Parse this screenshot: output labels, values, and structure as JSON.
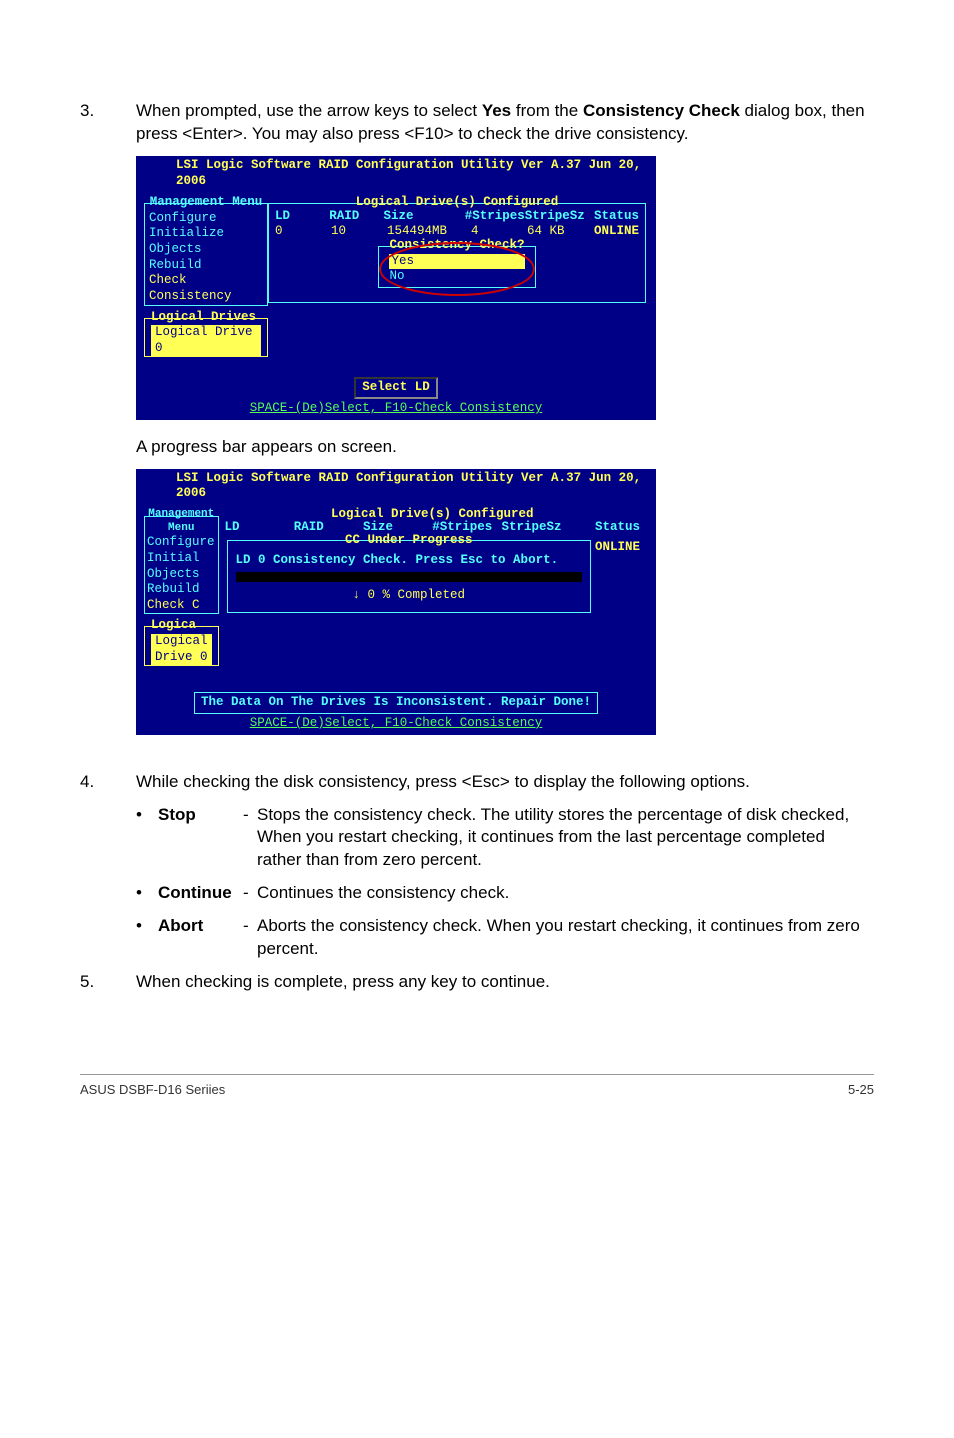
{
  "step3": {
    "num": "3.",
    "text_pre": "When prompted, use the arrow keys to select ",
    "bold1": "Yes",
    "text_mid": " from the ",
    "bold2": "Consistency Check",
    "text_post": " dialog box, then press <Enter>. You may also press <F10> to check the drive consistency."
  },
  "console1": {
    "title": "LSI Logic Software RAID Configuration Utility Ver A.37 Jun 20, 2006",
    "menu_title": "Management Menu",
    "menu_items": [
      "Configure",
      "Initialize",
      "Objects",
      "Rebuild",
      "Check Consistency"
    ],
    "ld_title": "Logical Drives",
    "ld_item": "Logical Drive 0",
    "tbl_title": "Logical Drive(s) Configured",
    "hdr": {
      "ld": "LD",
      "raid": "RAID",
      "size": "Size",
      "stripes": "#Stripes",
      "stripesz": "StripeSz",
      "status": "Status"
    },
    "r1": {
      "ld": "0",
      "raid": "10",
      "size": "154494MB",
      "stripes": "4",
      "stripesz": "64  KB",
      "status": "ONLINE"
    },
    "dlg_title": "Consistency Check?",
    "dlg_yes": "Yes",
    "dlg_no": "No",
    "button": "Select LD",
    "footer": "SPACE-(De)Select,  F10-Check Consistency"
  },
  "between": "A progress bar appears on screen.",
  "console2": {
    "title": "LSI Logic Software RAID Configuration Utility Ver A.37 Jun 20, 2006",
    "menu_title": "Management Menu",
    "menu_items": [
      "Configure",
      "Initial",
      "Objects",
      "Rebuild",
      "Check C"
    ],
    "tbl_title": "Logical Drive(s) Configured",
    "hdr": {
      "ld": "LD",
      "raid": "RAID",
      "size": "Size",
      "stripes": "#Stripes",
      "stripesz": "StripeSz",
      "status": "Status"
    },
    "status_value": "ONLINE",
    "panel_title": "CC Under Progress",
    "panel_msg": "LD 0 Consistency Check. Press Esc to Abort.",
    "pct": "↓ 0  % Completed",
    "ld_title": "Logica",
    "ld_item": "Logical Drive 0",
    "repair": "The Data On The Drives Is Inconsistent. Repair Done!",
    "footer": "SPACE-(De)Select,  F10-Check Consistency"
  },
  "step4": {
    "num": "4.",
    "text": "While checking the disk consistency, press <Esc> to display the following options.",
    "items": [
      {
        "label": "Stop",
        "dash": "-",
        "desc": "Stops the consistency check. The utility stores the percentage of disk checked, When you restart checking, it continues from the last percentage completed rather than from zero percent."
      },
      {
        "label": "Continue",
        "dash": "-",
        "desc": "Continues the consistency check."
      },
      {
        "label": "Abort",
        "dash": "-",
        "desc": "Aborts the consistency check. When you restart checking, it continues from zero percent."
      }
    ],
    "bullet": "•"
  },
  "step5": {
    "num": "5.",
    "text": "When checking is complete, press any key to continue."
  },
  "footer": {
    "left": "ASUS DSBF-D16 Seriies",
    "right": "5-25"
  }
}
